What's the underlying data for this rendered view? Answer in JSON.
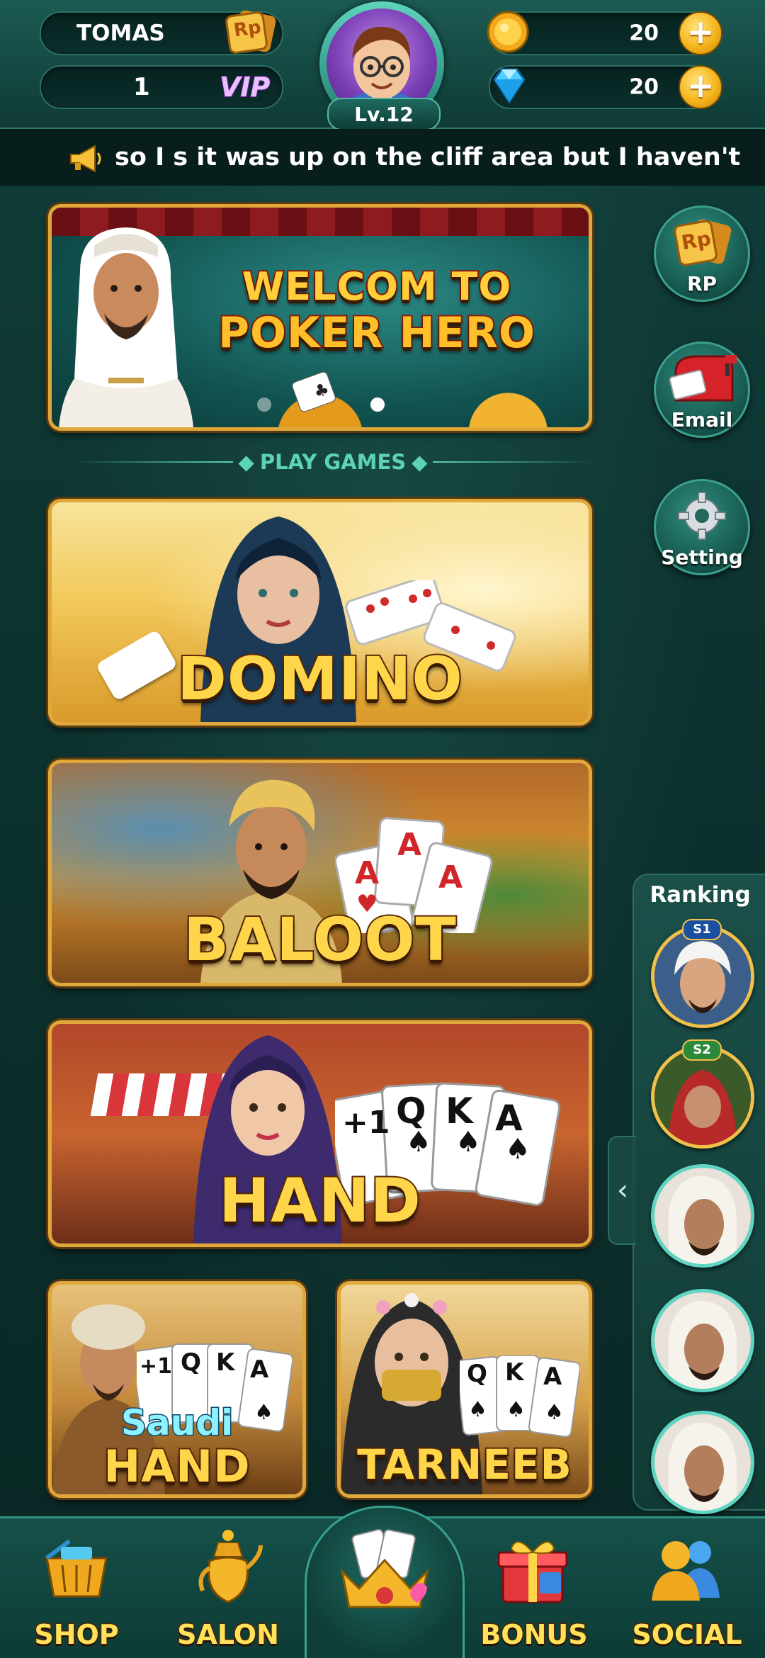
{
  "header": {
    "username": "TOMAS",
    "vip_level": "1",
    "vip_label": "VIP",
    "level": "Lv.12",
    "coins": "20",
    "diamonds": "20",
    "rp_icon_text": "Rp"
  },
  "ticker": {
    "message": "so I s it was up on the cliff area but I haven't"
  },
  "promo_banner": {
    "line1": "WELCOM TO",
    "line2": "POKER HERO"
  },
  "section_title": "PLAY GAMES",
  "games": {
    "domino": "DOMINO",
    "baloot": "BALOOT",
    "hand": "HAND",
    "saudi_hand_top": "Saudi",
    "saudi_hand_bottom": "HAND",
    "tarneeb": "TARNEEB"
  },
  "card_ranks": {
    "plus_one": "+1",
    "q": "Q",
    "k": "K",
    "a": "A"
  },
  "side_buttons": {
    "rp": "RP",
    "email": "Email",
    "setting": "Setting"
  },
  "ranking": {
    "title": "Ranking",
    "badge1": "S1",
    "badge2": "S2"
  },
  "bottom_nav": {
    "shop": "SHOP",
    "salon": "SALON",
    "bonus": "BONUS",
    "social": "SOCIAL"
  },
  "colors": {
    "accent_gold": "#ffd64a",
    "frame_gold": "#e0a73b",
    "teal": "#5cd3b5",
    "background": "#0e3531"
  }
}
